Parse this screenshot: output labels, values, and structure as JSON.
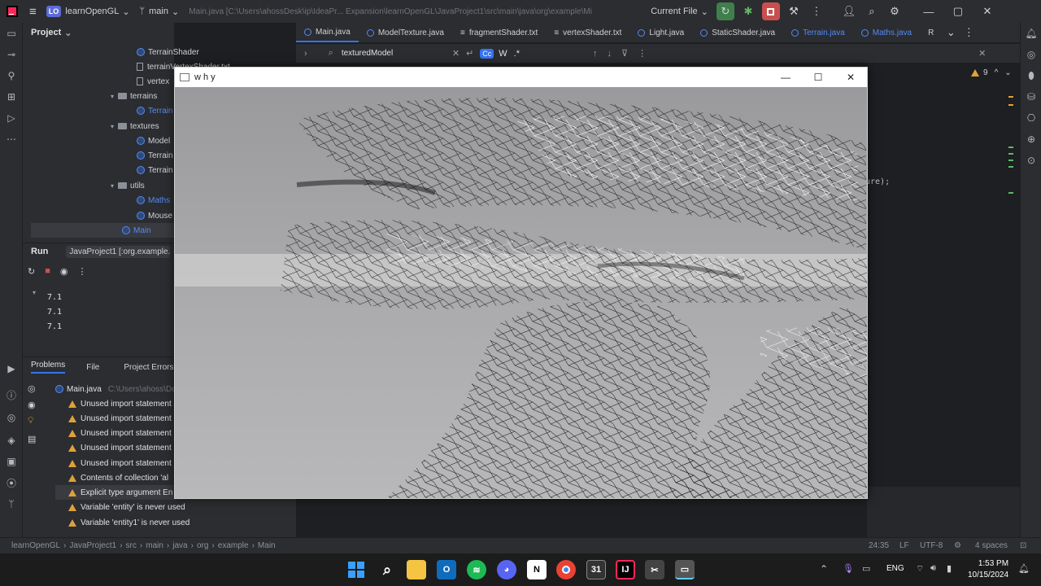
{
  "titlebar": {
    "project_badge": "LO",
    "project_name": "learnOpenGL",
    "branch": "main",
    "file_path": "Main.java [C:\\Users\\ahossDesk\\ip\\IdeaPr... Expansion\\learnOpenGL\\JavaProject1\\src\\main\\java\\org\\example\\Mi",
    "run_config": "Current File"
  },
  "project_panel": {
    "title": "Project",
    "tree": [
      {
        "label": "TerrainShader",
        "kind": "class"
      },
      {
        "label": "terrainVertexShader.txt",
        "kind": "text"
      },
      {
        "label": "vertex",
        "kind": "text"
      },
      {
        "label": "terrains",
        "kind": "folder"
      },
      {
        "label": "Terrain",
        "kind": "class"
      },
      {
        "label": "textures",
        "kind": "folder"
      },
      {
        "label": "Model",
        "kind": "class"
      },
      {
        "label": "Terrain",
        "kind": "class"
      },
      {
        "label": "Terrain",
        "kind": "class"
      },
      {
        "label": "utils",
        "kind": "folder"
      },
      {
        "label": "Maths",
        "kind": "class"
      },
      {
        "label": "Mouse",
        "kind": "class"
      },
      {
        "label": "Main",
        "kind": "class"
      }
    ]
  },
  "tabs": [
    "Main.java",
    "ModelTexture.java",
    "fragmentShader.txt",
    "vertexShader.txt",
    "Light.java",
    "StaticShader.java",
    "Terrain.java",
    "Maths.java",
    "R"
  ],
  "find": {
    "query": "texturedModel",
    "option_cc": "Cc",
    "option_w": "W",
    "option_regex": ".*"
  },
  "editor": {
    "warning_count": "9",
    "code_fragment": "ure);"
  },
  "run_panel": {
    "title": "Run",
    "config": "JavaProject1 [:org.example...",
    "output": [
      "7.1",
      "7.1",
      "7.1"
    ]
  },
  "problems": {
    "tabs": [
      "Problems",
      "File",
      "Project Errors"
    ],
    "file": "Main.java",
    "file_hint": "C:\\Users\\ahoss\\Desk",
    "items": [
      "Unused import statement",
      "Unused import statement",
      "Unused import statement",
      "Unused import statement",
      "Unused import statement",
      "Contents of collection 'al",
      "Explicit type argument En",
      "Variable 'entity' is never used",
      "Variable 'entity1' is never used"
    ]
  },
  "statusbar": {
    "breadcrumbs": [
      "learnOpenGL",
      "JavaProject1",
      "src",
      "main",
      "java",
      "org",
      "example",
      "Main"
    ],
    "position": "24:35",
    "line_sep": "LF",
    "encoding": "UTF-8",
    "indent": "4 spaces"
  },
  "app_window": {
    "title": "w h y"
  },
  "taskbar": {
    "lang": "ENG",
    "time": "1:53 PM",
    "date": "10/15/2024"
  }
}
